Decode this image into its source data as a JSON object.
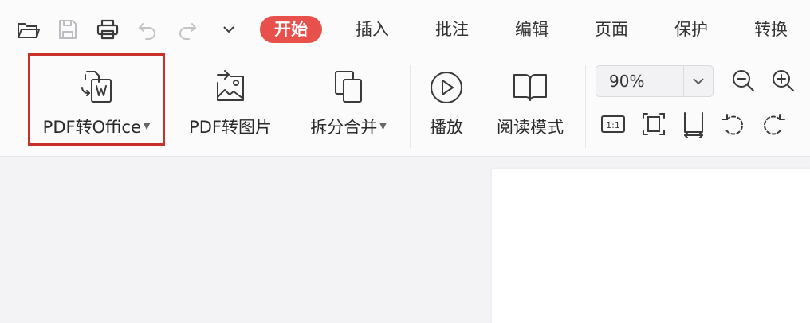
{
  "quick_access": {
    "icons": [
      "open-folder-icon",
      "save-icon",
      "print-icon",
      "undo-icon",
      "redo-icon",
      "customize-dropdown-icon"
    ]
  },
  "tabs": [
    {
      "label": "开始",
      "active": true
    },
    {
      "label": "插入",
      "active": false
    },
    {
      "label": "批注",
      "active": false
    },
    {
      "label": "编辑",
      "active": false
    },
    {
      "label": "页面",
      "active": false
    },
    {
      "label": "保护",
      "active": false
    },
    {
      "label": "转换",
      "active": false
    }
  ],
  "ribbon": {
    "pdf_to_office": "PDF转Office",
    "pdf_to_image": "PDF转图片",
    "split_merge": "拆分合并",
    "play": "播放",
    "reading_mode": "阅读模式"
  },
  "zoom": {
    "value": "90%",
    "icons": [
      "zoom-out-icon",
      "zoom-in-icon",
      "actual-size-icon",
      "fit-page-icon",
      "fit-width-icon",
      "rotate-left-icon",
      "rotate-right-icon"
    ]
  },
  "colors": {
    "active_tab": "#e8504b",
    "highlight_border": "#c9302c",
    "icon_stroke": "#3a3a3a"
  }
}
